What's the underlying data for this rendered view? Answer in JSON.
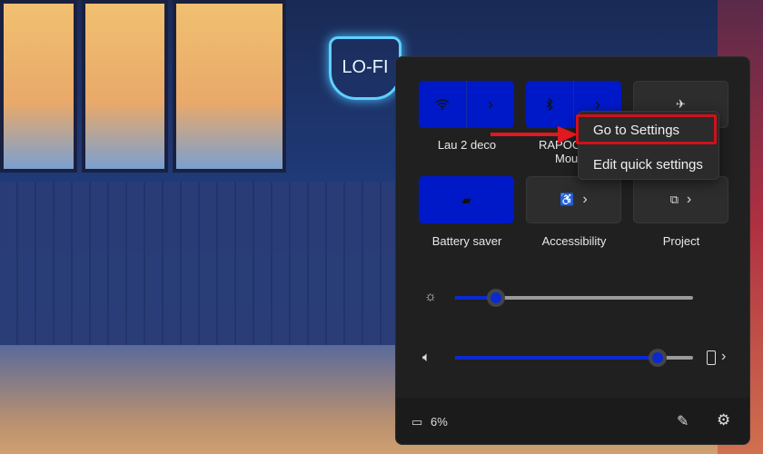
{
  "quick_settings": {
    "tiles": [
      {
        "label": "Lau 2 deco",
        "icon": "wifi-icon",
        "state": "on",
        "has_chevron": true
      },
      {
        "label": "RAPOO",
        "label_line2": "Mou",
        "icon": "bluetooth-icon",
        "state": "on",
        "has_chevron": true
      },
      {
        "label": "",
        "icon": "airplane-icon",
        "state": "off"
      },
      {
        "label": "Battery saver",
        "icon": "battery-saver-icon",
        "state": "on"
      },
      {
        "label": "Accessibility",
        "icon": "accessibility-icon",
        "state": "off",
        "has_chevron": true
      },
      {
        "label": "Project",
        "icon": "project-icon",
        "state": "off",
        "has_chevron": true
      }
    ],
    "brightness_percent": 17,
    "volume_percent": 85,
    "battery_text": "6%",
    "chevron": "›",
    "accent_color": "#0019c8"
  },
  "context_menu": {
    "items": [
      "Go to Settings",
      "Edit quick settings"
    ],
    "highlight_color": "#d0101a"
  },
  "background": {
    "neon_sign": "LO-FI"
  }
}
